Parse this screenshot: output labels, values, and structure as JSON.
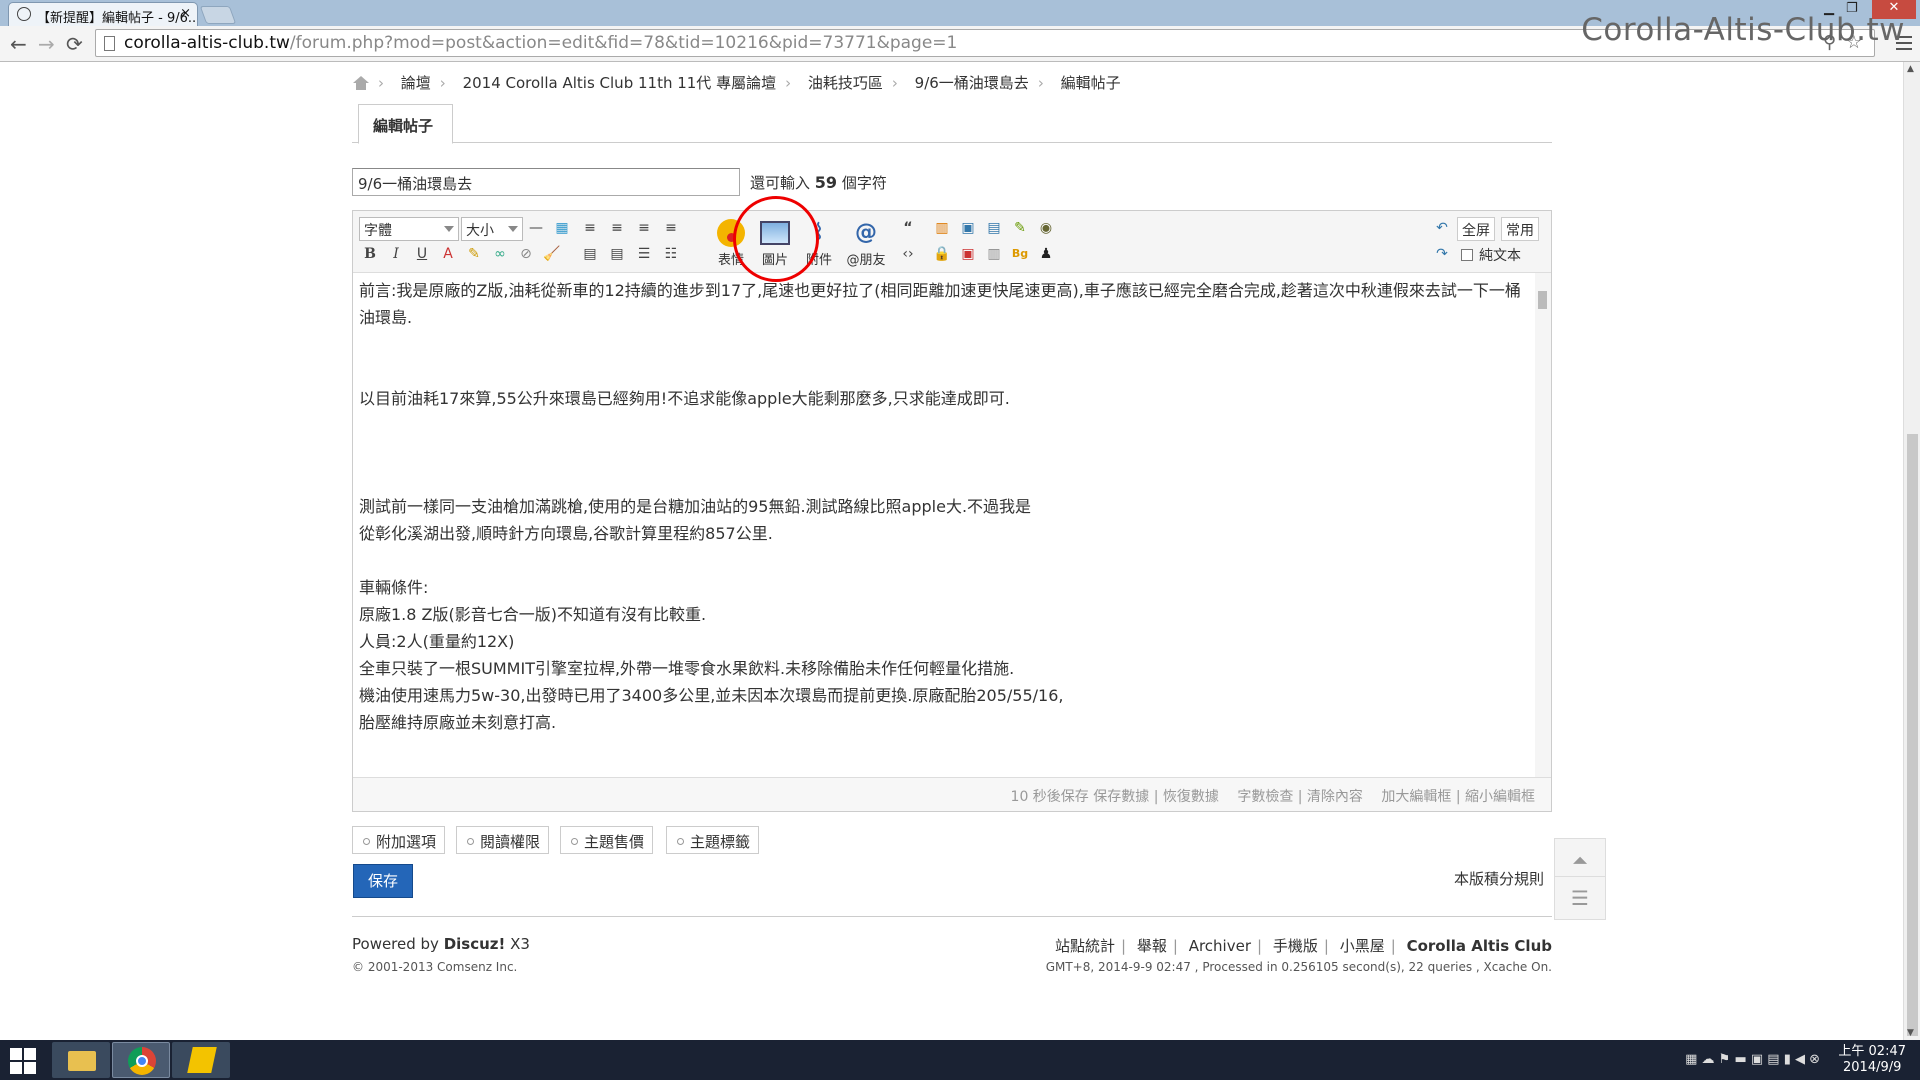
{
  "browser": {
    "tab_title": "【新提醒】編輯帖子 - 9/6...",
    "tab_close": "×",
    "url_host": "corolla-altis-club.tw",
    "url_path": "/forum.php?mod=post&action=edit&fid=78&tid=10216&pid=73771&page=1",
    "watermark": "Corolla-Altis-Club.tw",
    "back": "←",
    "forward": "→",
    "reload": "⟳"
  },
  "breadcrumb": {
    "items": [
      "論壇",
      "2014 Corolla Altis Club 11th 11代 專屬論壇",
      "油耗技巧區",
      "9/6一桶油環島去",
      "編輯帖子"
    ],
    "sep": "›"
  },
  "page_tab": "編輯帖子",
  "subject": {
    "value": "9/6一桶油環島去",
    "remaining_prefix": "還可輸入 ",
    "remaining_count": "59",
    "remaining_suffix": " 個字符"
  },
  "editor": {
    "font_select": "字體",
    "size_select": "大小",
    "big_buttons": [
      "表情",
      "圖片",
      "附件",
      "@朋友"
    ],
    "fullscreen": "全屏",
    "common": "常用",
    "plaintext": "純文本",
    "content": "前言:我是原廠的Z版,油耗從新車的12持續的進步到17了,尾速也更好拉了(相同距離加速更快尾速更高),車子應該已經完全磨合完成,趁著這次中秋連假來去試一下一桶油環島.\n\n\n以目前油耗17來算,55公升來環島已經夠用!不追求能像apple大能剩那麼多,只求能達成即可.\n\n\n\n測試前一樣同一支油槍加滿跳槍,使用的是台糖加油站的95無鉛.測試路線比照apple大.不過我是\n從彰化溪湖出發,順時針方向環島,谷歌計算里程約857公里.\n\n車輛條件:\n原廠1.8 Z版(影音七合一版)不知道有沒有比較重.\n人員:2人(重量約12X)\n全車只裝了一根SUMMIT引擎室拉桿,外帶一堆零食水果飲料.未移除備胎未作任何輕量化措施.\n機油使用速馬力5w-30,出發時已用了3400多公里,並未因本次環島而提前更換.原廠配胎205/55/16,\n胎壓維持原廠並未刻意打高.",
    "status": "10 秒後保存 保存數據 | 恢復數據　 字數檢查 | 清除內容　 加大編輯框 | 縮小編輯框"
  },
  "options": [
    "附加選項",
    "閱讀權限",
    "主題售價",
    "主題標籤"
  ],
  "save_button": "保存",
  "rules_link": "本版積分規則",
  "footer": {
    "powered_prefix": "Powered by ",
    "powered_brand": "Discuz!",
    "powered_version": " X3",
    "copyright": "© 2001-2013 Comsenz Inc.",
    "links": [
      "站點統計",
      "舉報",
      "Archiver",
      "手機版",
      "小黑屋"
    ],
    "site_name": "Corolla Altis Club",
    "info": "GMT+8, 2014-9-9 02:47 , Processed in 0.256105 second(s), 22 queries , Xcache On."
  },
  "taskbar": {
    "time": "上午 02:47",
    "date": "2014/9/9"
  },
  "colors": {
    "accent": "#2466b8",
    "annotation": "#e00000"
  }
}
